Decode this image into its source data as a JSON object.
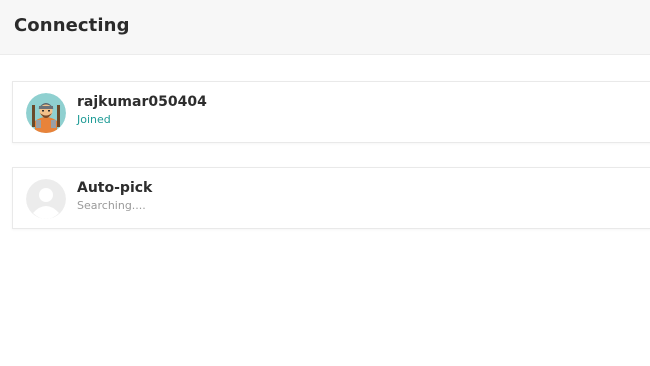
{
  "header": {
    "title": "Connecting"
  },
  "players": [
    {
      "name": "rajkumar050404",
      "status": "Joined",
      "avatar_icon": "warrior-avatar-icon",
      "status_color": "#1e9b96"
    },
    {
      "name": "Auto-pick",
      "status": "Searching....",
      "avatar_icon": "default-user-avatar-icon",
      "status_color": "#9a9a9a"
    }
  ],
  "colors": {
    "header_bg": "#f7f7f7",
    "accent_teal": "#1e9b96"
  }
}
